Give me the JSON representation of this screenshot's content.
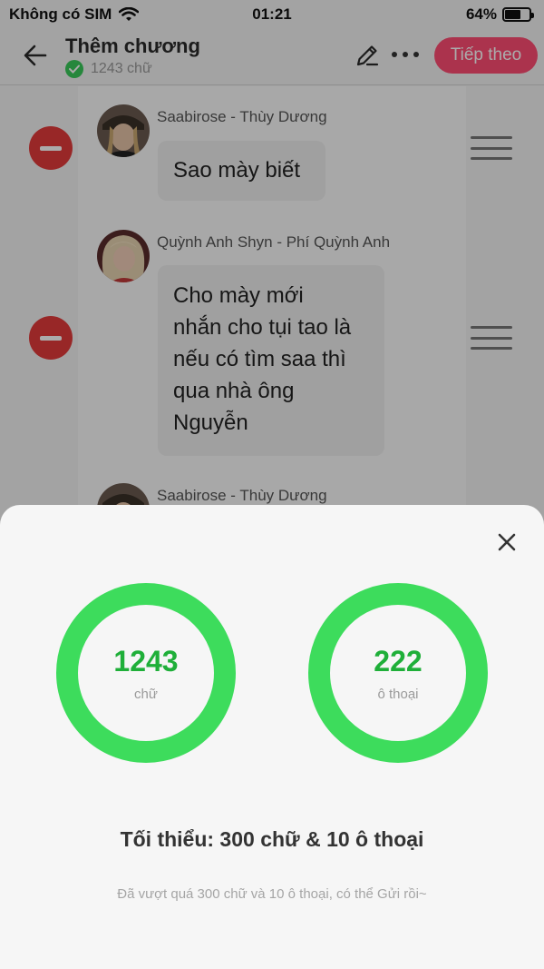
{
  "status_bar": {
    "carrier": "Không có SIM",
    "time": "01:21",
    "battery_percent": "64%",
    "battery_level": 0.64
  },
  "header": {
    "title": "Thêm chương",
    "word_count": "1243 chữ",
    "next_label": "Tiếp theo"
  },
  "messages": [
    {
      "sender": "Saabirose - Thùy Dương",
      "text": "Sao mày biết"
    },
    {
      "sender": "Quỳnh Anh Shyn - Phí Quỳnh Anh",
      "lines": [
        "Cho mày mới",
        "nhắn cho tụi tao là",
        "nếu có tìm saa thì",
        "qua nhà ông",
        "Nguyễn"
      ]
    },
    {
      "sender": "Saabirose - Thùy Dương"
    }
  ],
  "sheet": {
    "words": {
      "value": "1243",
      "unit": "chữ"
    },
    "dialogues": {
      "value": "222",
      "unit": "ô thoại"
    },
    "minimum_text": "Tối thiểu: 300 chữ & 10 ô thoại",
    "hint_text": "Đã vượt quá 300 chữ và 10 ô thoại, có thể Gửi rồi~"
  },
  "colors": {
    "accent_pink": "#ff4d73",
    "ring_green": "#3ddc5c",
    "number_green": "#1faf39",
    "remove_red": "#e33b3b"
  }
}
